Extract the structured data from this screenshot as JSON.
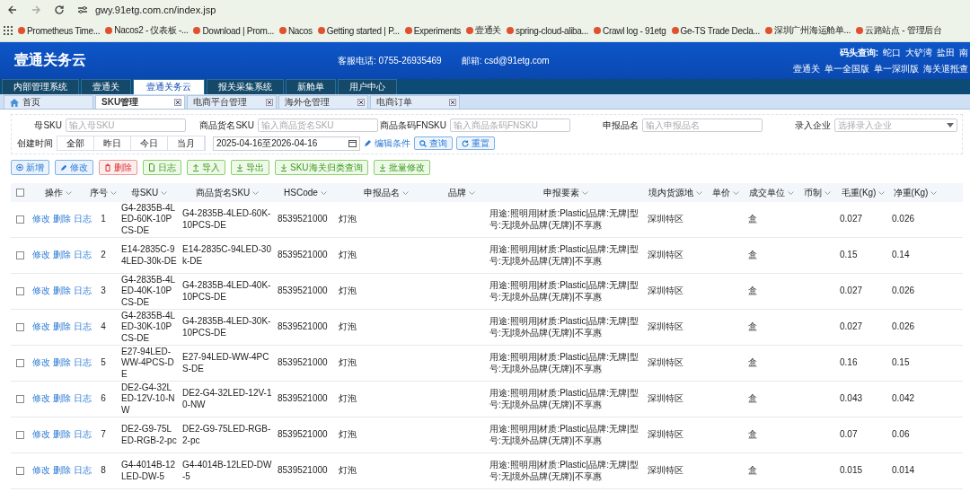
{
  "browser": {
    "url": "gwy.91etg.com.cn/index.jsp",
    "bookmarks": [
      "Prometheus Time...",
      "Nacos2 - 仪表板 -...",
      "Download | Prom...",
      "Nacos",
      "Getting started | P...",
      "Experiments",
      "壹通关",
      "spring-cloud-aliba...",
      "Crawl log - 91etg",
      "Ge-TS Trade Decla...",
      "深圳广州海运舱单...",
      "云路站点 - 管理后台"
    ]
  },
  "header": {
    "logo": "壹通关务云",
    "phone_label": "客服电话:",
    "phone": "0755-26935469",
    "email_label": "邮箱:",
    "email": "csd@91etg.com",
    "port_label": "码头查询:",
    "ports": [
      "蛇口",
      "大铲湾",
      "盐田",
      "南"
    ],
    "links": [
      "壹通关",
      "单一全国版",
      "单一深圳版",
      "海关退抵查"
    ]
  },
  "nav_tabs": [
    {
      "label": "内部管理系统",
      "selected": false
    },
    {
      "label": "壹通关",
      "selected": false
    },
    {
      "label": "壹通关务云",
      "selected": true
    },
    {
      "label": "报关采集系统",
      "selected": false
    },
    {
      "label": "新舱单",
      "selected": false
    },
    {
      "label": "用户中心",
      "selected": false
    }
  ],
  "page_tabs": [
    {
      "label": "首页",
      "selected": false,
      "closable": false
    },
    {
      "label": "SKU管理",
      "selected": true,
      "closable": true
    },
    {
      "label": "电商平台管理",
      "selected": false,
      "closable": true
    },
    {
      "label": "海外仓管理",
      "selected": false,
      "closable": true
    },
    {
      "label": "电商订单",
      "selected": false,
      "closable": true
    }
  ],
  "filters": [
    {
      "label": "母SKU",
      "placeholder": "输入母SKU",
      "kind": "input"
    },
    {
      "label": "商品货名SKU",
      "placeholder": "输入商品货名SKU",
      "kind": "input"
    },
    {
      "label": "商品条码FNSKU",
      "placeholder": "输入商品条码FNSKU",
      "kind": "input"
    },
    {
      "label": "申报品名",
      "placeholder": "输入申报品名",
      "kind": "input"
    },
    {
      "label": "录入企业",
      "placeholder": "选择录入企业",
      "kind": "select"
    }
  ],
  "created_time": {
    "label": "创建时间",
    "ranges": [
      {
        "label": "全部",
        "selected": false
      },
      {
        "label": "昨日",
        "selected": false
      },
      {
        "label": "今日",
        "selected": false
      },
      {
        "label": "当月",
        "selected": false
      }
    ],
    "value": "2025-04-16至2026-04-16",
    "edit_link": "编辑条件",
    "search": "查询",
    "reset": "重置"
  },
  "actions": [
    {
      "label": "新增",
      "kind": "add"
    },
    {
      "label": "修改",
      "kind": "edit"
    },
    {
      "label": "删除",
      "kind": "delete"
    },
    {
      "label": "日志",
      "kind": "log"
    },
    {
      "label": "导入",
      "kind": "import"
    },
    {
      "label": "导出",
      "kind": "export"
    },
    {
      "label": "SKU海关归类查询",
      "kind": "export"
    },
    {
      "label": "批量修改",
      "kind": "export"
    }
  ],
  "table": {
    "select_all_checked": false,
    "columns": [
      "操作",
      "序号",
      "母SKU",
      "商品货名SKU",
      "HSCode",
      "申报品名",
      "品牌",
      "申报要素",
      "境内货源地",
      "单价",
      "成交单位",
      "币制",
      "毛重(Kg)",
      "净重(Kg)"
    ],
    "rows": [
      {
        "checked": false,
        "actions": [
          "修改",
          "删除",
          "日志"
        ],
        "no": "1",
        "parent_sku": "G4-2835B-4LED-60K-10PCS-DE",
        "sku": "G4-2835B-4LED-60K-10PCS-DE",
        "hscode": "8539521000",
        "name": "灯泡",
        "elements": "用途:照明用|材质:Plastic|品牌:无牌|型号:无|境外品牌(无牌)|不享惠",
        "origin": "深圳特区",
        "unit": "盒",
        "gross": "0.027",
        "net": "0.026"
      },
      {
        "checked": false,
        "actions": [
          "修改",
          "删除",
          "日志"
        ],
        "no": "2",
        "parent_sku": "E14-2835C-94LED-30k-DE",
        "sku": "E14-2835C-94LED-30k-DE",
        "hscode": "8539521000",
        "name": "灯泡",
        "elements": "用途:照明用|材质:Plastic|品牌:无牌|型号:无|境外品牌(无牌)|不享惠",
        "origin": "深圳特区",
        "unit": "盒",
        "gross": "0.15",
        "net": "0.14"
      },
      {
        "checked": false,
        "actions": [
          "修改",
          "删除",
          "日志"
        ],
        "no": "3",
        "parent_sku": "G4-2835B-4LED-40K-10PCS-DE",
        "sku": "G4-2835B-4LED-40K-10PCS-DE",
        "hscode": "8539521000",
        "name": "灯泡",
        "elements": "用途:照明用|材质:Plastic|品牌:无牌|型号:无|境外品牌(无牌)|不享惠",
        "origin": "深圳特区",
        "unit": "盒",
        "gross": "0.027",
        "net": "0.026"
      },
      {
        "checked": false,
        "actions": [
          "修改",
          "删除",
          "日志"
        ],
        "no": "4",
        "parent_sku": "G4-2835B-4LED-30K-10PCS-DE",
        "sku": "G4-2835B-4LED-30K-10PCS-DE",
        "hscode": "8539521000",
        "name": "灯泡",
        "elements": "用途:照明用|材质:Plastic|品牌:无牌|型号:无|境外品牌(无牌)|不享惠",
        "origin": "深圳特区",
        "unit": "盒",
        "gross": "0.027",
        "net": "0.026"
      },
      {
        "checked": false,
        "actions": [
          "修改",
          "删除",
          "日志"
        ],
        "no": "5",
        "parent_sku": "E27-94LED-WW-4PCS-DE",
        "sku": "E27-94LED-WW-4PCS-DE",
        "hscode": "8539521000",
        "name": "灯泡",
        "elements": "用途:照明用|材质:Plastic|品牌:无牌|型号:无|境外品牌(无牌)|不享惠",
        "origin": "深圳特区",
        "unit": "盒",
        "gross": "0.16",
        "net": "0.15"
      },
      {
        "checked": false,
        "actions": [
          "修改",
          "删除",
          "日志"
        ],
        "no": "6",
        "parent_sku": "DE2-G4-32LED-12V-10-NW",
        "sku": "DE2-G4-32LED-12V-10-NW",
        "hscode": "8539521000",
        "name": "灯泡",
        "elements": "用途:照明用|材质:Plastic|品牌:无牌|型号:无|境外品牌(无牌)|不享惠",
        "origin": "深圳特区",
        "unit": "盒",
        "gross": "0.043",
        "net": "0.042"
      },
      {
        "checked": false,
        "actions": [
          "修改",
          "删除",
          "日志"
        ],
        "no": "7",
        "parent_sku": "DE2-G9-75LED-RGB-2-pc",
        "sku": "DE2-G9-75LED-RGB-2-pc",
        "hscode": "8539521000",
        "name": "灯泡",
        "elements": "用途:照明用|材质:Plastic|品牌:无牌|型号:无|境外品牌(无牌)|不享惠",
        "origin": "深圳特区",
        "unit": "盒",
        "gross": "0.07",
        "net": "0.06"
      },
      {
        "checked": false,
        "actions": [
          "修改",
          "删除",
          "日志"
        ],
        "no": "8",
        "parent_sku": "G4-4014B-12LED-DW-5",
        "sku": "G4-4014B-12LED-DW-5",
        "hscode": "8539521000",
        "name": "灯泡",
        "elements": "用途:照明用|材质:Plastic|品牌:无牌|型号:无|境外品牌(无牌)|不享惠",
        "origin": "深圳特区",
        "unit": "盒",
        "gross": "0.015",
        "net": "0.014"
      }
    ]
  }
}
